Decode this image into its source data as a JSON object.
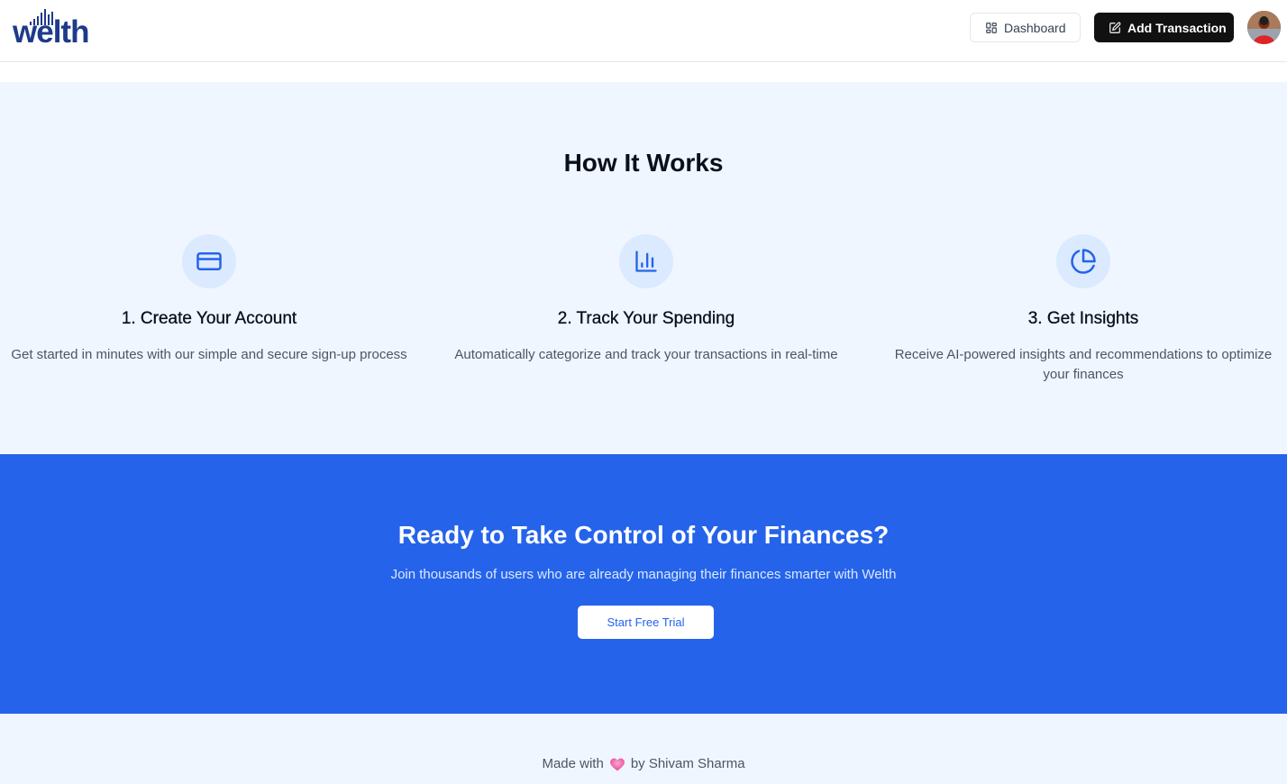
{
  "header": {
    "logo_text": "welth",
    "dashboard_label": "Dashboard",
    "add_transaction_label": "Add Transaction"
  },
  "how_it_works": {
    "title": "How It Works",
    "steps": [
      {
        "icon": "credit-card-icon",
        "title": "1. Create Your Account",
        "description": "Get started in minutes with our simple and secure sign-up process"
      },
      {
        "icon": "bar-chart-icon",
        "title": "2. Track Your Spending",
        "description": "Automatically categorize and track your transactions in real-time"
      },
      {
        "icon": "pie-chart-icon",
        "title": "3. Get Insights",
        "description": "Receive AI-powered insights and recommendations to optimize your finances"
      }
    ]
  },
  "cta": {
    "title": "Ready to Take Control of Your Finances?",
    "subtitle": "Join thousands of users who are already managing their finances smarter with Welth",
    "button_label": "Start Free Trial"
  },
  "footer": {
    "made_with": "Made with",
    "by": "by Shivam Sharma"
  },
  "colors": {
    "brand_navy": "#1e3a8a",
    "primary_blue": "#2563eb",
    "light_blue_bg": "#eff6ff",
    "icon_circle": "#dbeafe",
    "heart": "#ec4899"
  }
}
